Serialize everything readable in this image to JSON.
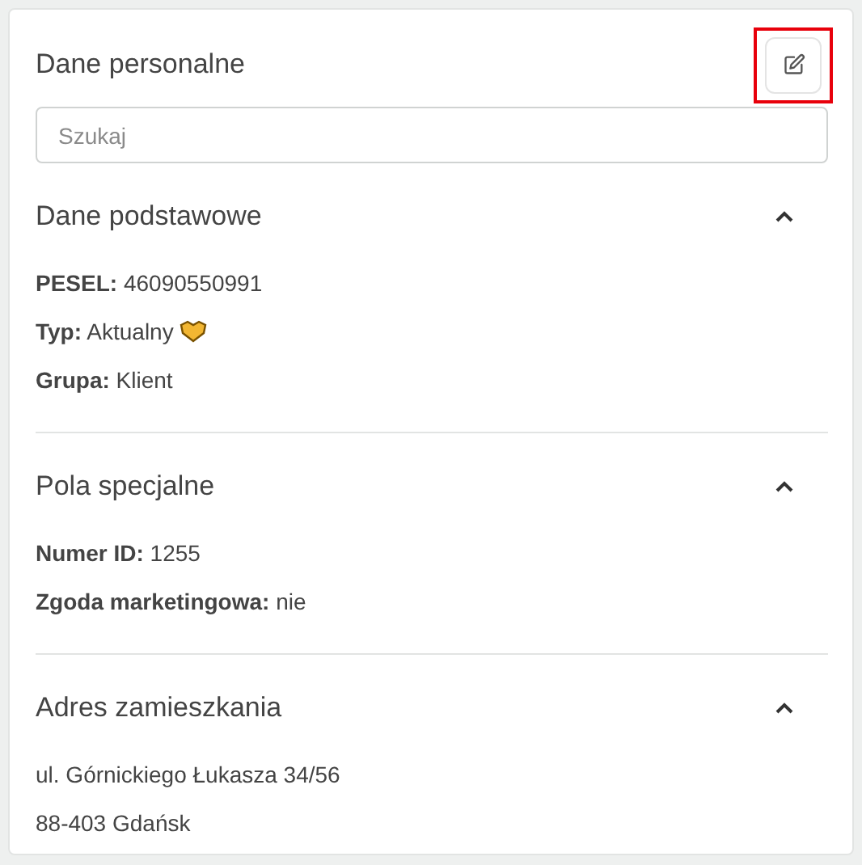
{
  "panel": {
    "title": "Dane personalne",
    "edit_button": {
      "highlighted": true
    }
  },
  "search": {
    "placeholder": "Szukaj"
  },
  "sections": [
    {
      "title": "Dane podstawowe",
      "expanded": true,
      "rows": [
        {
          "kind": "field",
          "label": "PESEL:",
          "value": "46090550991",
          "icon": false
        },
        {
          "kind": "field",
          "label": "Typ:",
          "value": "Aktualny",
          "icon": true
        },
        {
          "kind": "field",
          "label": "Grupa:",
          "value": "Klient",
          "icon": false
        }
      ]
    },
    {
      "title": "Pola specjalne",
      "expanded": true,
      "rows": [
        {
          "kind": "field",
          "label": "Numer ID:",
          "value": "1255",
          "icon": false
        },
        {
          "kind": "field",
          "label": "Zgoda marketingowa:",
          "value": "nie",
          "icon": false
        }
      ]
    },
    {
      "title": "Adres zamieszkania",
      "expanded": true,
      "rows": [
        {
          "kind": "line",
          "value": "ul. Górnickiego Łukasza 34/56"
        },
        {
          "kind": "line",
          "value": "88-403 Gdańsk"
        }
      ]
    }
  ]
}
